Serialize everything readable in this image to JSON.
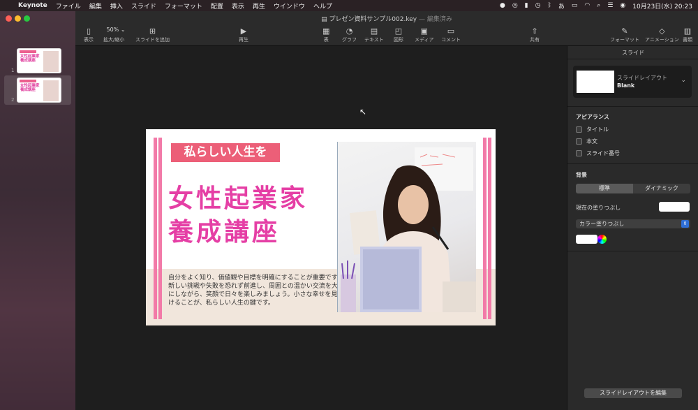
{
  "menubar": {
    "app": "Keynote",
    "items": [
      "ファイル",
      "編集",
      "挿入",
      "スライド",
      "フォーマット",
      "配置",
      "表示",
      "再生",
      "ウインドウ",
      "ヘルプ"
    ],
    "ime": "あ",
    "datetime": "10月23日(水)  20:23"
  },
  "window": {
    "title": "プレゼン資料サンプル002.key",
    "title_sep": "—",
    "title_status": "編集済み"
  },
  "toolbar": {
    "view": "表示",
    "zoom_value": "50%",
    "zoom_label": "拡大/縮小",
    "add_slide": "スライドを追加",
    "play": "再生",
    "table": "表",
    "chart": "グラフ",
    "text": "テキスト",
    "shape": "図形",
    "media": "メディア",
    "comment": "コメント",
    "share": "共有",
    "format": "フォーマット",
    "animate": "アニメーション",
    "document": "書類"
  },
  "navigator": {
    "slides": [
      {
        "number": "1",
        "title_line1": "女性起業家",
        "title_line2": "養成講座"
      },
      {
        "number": "2",
        "title_line1": "女性起業家",
        "title_line2": "養成講座"
      }
    ]
  },
  "slide": {
    "badge": "私らしい人生を",
    "headline_line1": "女性起業家",
    "headline_line2": "養成講座",
    "body": "自分をよく知り、価値観や目標を明確にすることが重要です。新しい挑戦や失敗を恐れず前進し、周囲との温かい交流を大切にしながら、笑顔で日々を楽しみましょう。小さな幸せを見つけることが、私らしい人生の鍵です。"
  },
  "inspector": {
    "title": "スライド",
    "layout_label": "スライドレイアウト",
    "layout_value": "Blank",
    "appearance_heading": "アピアランス",
    "appearance_options": [
      "タイトル",
      "本文",
      "スライド番号"
    ],
    "background_heading": "背景",
    "bg_tab_standard": "標準",
    "bg_tab_dynamic": "ダイナミック",
    "current_fill_label": "現在の塗りつぶし",
    "fill_type": "カラー塗りつぶし",
    "edit_layout_button": "スライドレイアウトを編集"
  },
  "colors": {
    "accent_pink": "#e53fa5",
    "badge_red": "#ec5f78",
    "stripe_pink": "#f27aa8",
    "beige": "#f1e6dc"
  }
}
